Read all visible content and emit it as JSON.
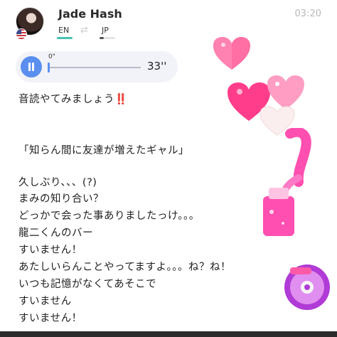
{
  "header": {
    "contact_name": "Jade Hash",
    "time": "03:20",
    "lang_from": "EN",
    "lang_to": "JP"
  },
  "voice_message": {
    "progress_label": "0\"",
    "duration": "33''"
  },
  "message": {
    "line1": "音読やてみましょう",
    "line1_emphasis": "‼️",
    "title": "「知らん間に友達が増えたギャル」",
    "lines": [
      "久しぶり、、、(?)",
      "まみの知り合い？",
      "どっかで会った事ありましたっけ。。。",
      "龍二くんのバー",
      "すいません！",
      "あたしいらんことやってますよ。。。ね？ね！",
      "いつも記憶がなくてあそこで",
      "すいません",
      "すいません！"
    ]
  },
  "icons": {
    "avatar": "avatar-photo",
    "flag": "us-flag-icon",
    "swap": "swap-icon",
    "pause": "pause-icon"
  },
  "colors": {
    "accent_teal": "#47c3b2",
    "accent_blue": "#5a8ff0",
    "emphasis_red": "#d7303c"
  }
}
